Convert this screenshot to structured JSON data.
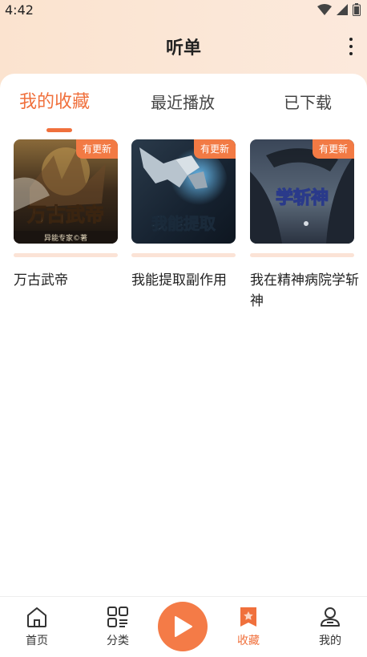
{
  "status": {
    "time": "4:42"
  },
  "header": {
    "title": "听单"
  },
  "tabs": [
    {
      "label": "我的收藏",
      "active": true
    },
    {
      "label": "最近播放",
      "active": false
    },
    {
      "label": "已下载",
      "active": false
    }
  ],
  "books": [
    {
      "title": "万古武帝",
      "badge": "有更新",
      "cover_text": "万古武帝",
      "cover_author": "异能专家©著"
    },
    {
      "title": "我能提取副作用",
      "badge": "有更新",
      "cover_text": "我能提取"
    },
    {
      "title": "我在精神病院学斩神",
      "badge": "有更新",
      "cover_text": "学斩神"
    }
  ],
  "tabbar": [
    {
      "label": "首页",
      "icon": "home-icon"
    },
    {
      "label": "分类",
      "icon": "category-icon"
    },
    {
      "label": "收藏",
      "icon": "bookmark-star-icon",
      "active": true
    },
    {
      "label": "我的",
      "icon": "profile-icon"
    }
  ],
  "colors": {
    "accent": "#f0703c",
    "badge": "#f27a44"
  }
}
